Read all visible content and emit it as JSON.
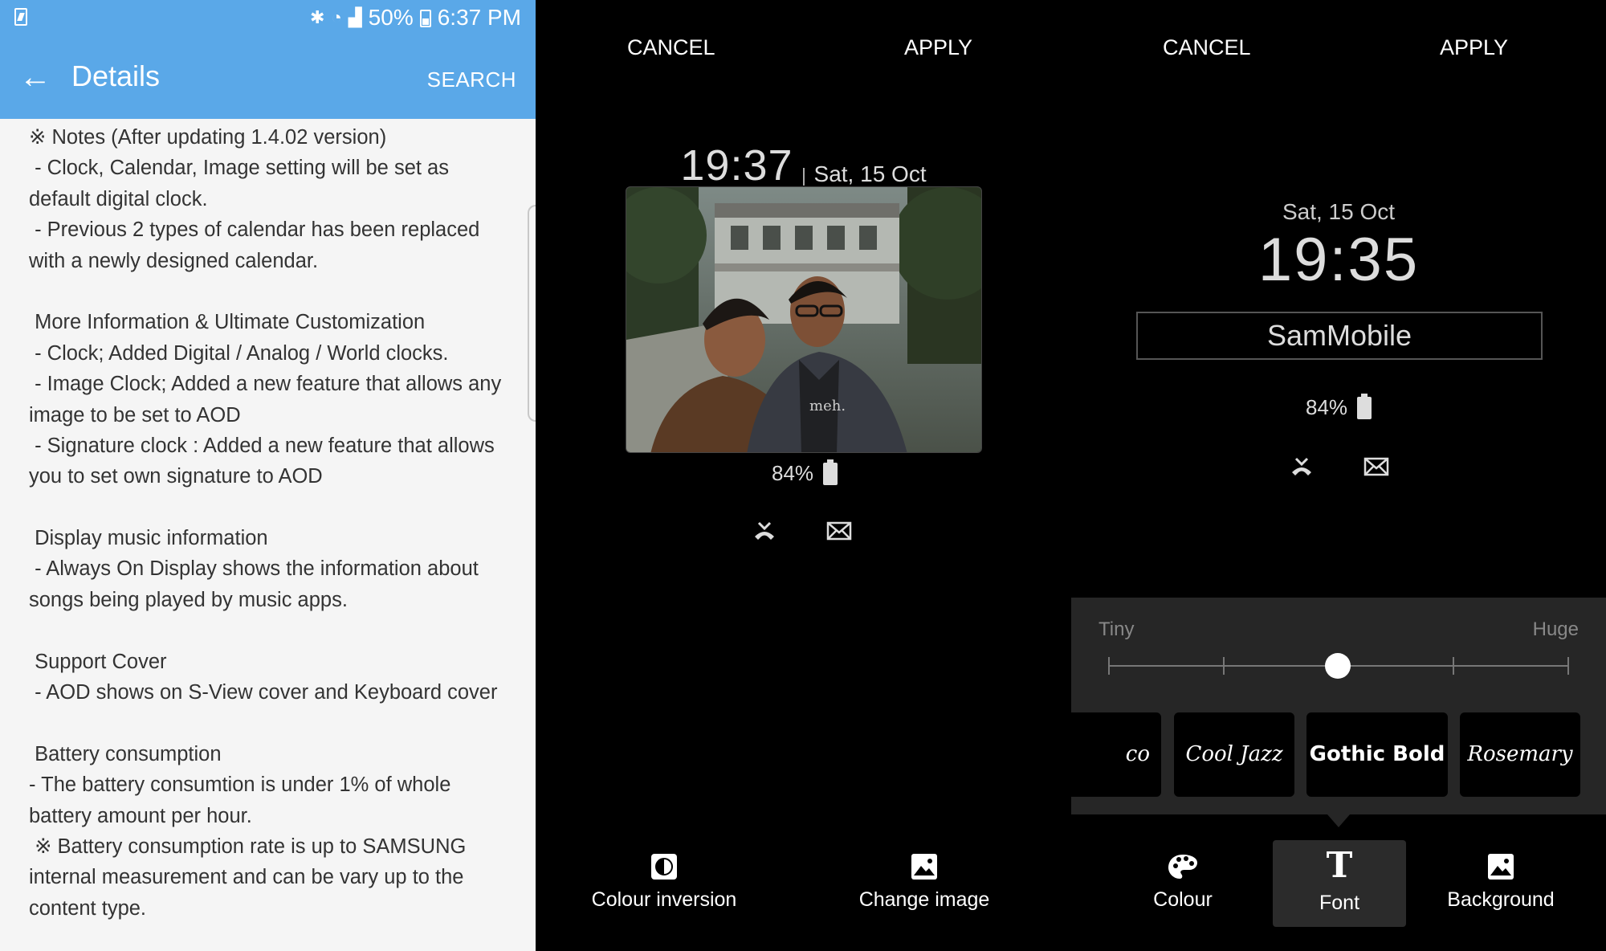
{
  "panel1": {
    "status": {
      "battery": "50%",
      "time": "6:37 PM"
    },
    "appbar": {
      "back_glyph": "←",
      "title": "Details",
      "search": "SEARCH"
    },
    "notes": [
      "※ Notes (After updating 1.4.02 version)",
      " - Clock, Calendar, Image setting will be set as",
      "default digital clock.",
      " - Previous 2 types of calendar has been replaced",
      "with a newly designed calendar.",
      "",
      " More Information & Ultimate Customization",
      " - Clock; Added Digital / Analog / World clocks.",
      " - Image Clock; Added a new feature that allows any",
      "image to be set to AOD",
      " - Signature clock : Added a new feature that allows",
      "you to set own signature to AOD",
      "",
      " Display music information",
      " - Always On Display shows the information about",
      "songs being played by music apps.",
      "",
      " Support Cover",
      " - AOD shows on S-View cover and Keyboard cover",
      "",
      " Battery consumption",
      "- The battery consumtion is under 1% of whole",
      "battery amount per hour.",
      " ※ Battery consumption rate is up to SAMSUNG",
      "internal measurement and can be vary up to the",
      "content type."
    ]
  },
  "panel2": {
    "cancel": "CANCEL",
    "apply": "APPLY",
    "time": "19:37",
    "date": "Sat, 15 Oct",
    "photo_text": "meh.",
    "battery": "84%",
    "options": [
      {
        "label": "Colour inversion",
        "icon": "colour-inversion-icon"
      },
      {
        "label": "Change image",
        "icon": "image-icon"
      }
    ]
  },
  "panel3": {
    "cancel": "CANCEL",
    "apply": "APPLY",
    "date": "Sat, 15 Oct",
    "time": "19:35",
    "signature": "SamMobile",
    "battery": "84%",
    "size": {
      "min_label": "Tiny",
      "max_label": "Huge",
      "steps": 5,
      "selected_step": 3
    },
    "fonts": [
      "co cooky",
      "Cool Jazz",
      "Gothic Bold",
      "Rosemary"
    ],
    "selected_font": "Gothic Bold",
    "tabs": [
      {
        "label": "Colour",
        "icon": "palette-icon"
      },
      {
        "label": "Font",
        "icon": "font-icon",
        "selected": true
      },
      {
        "label": "Background",
        "icon": "image-icon"
      }
    ]
  },
  "colors": {
    "accent_blue": "#5aa8e8",
    "panel_bg_dark": "#262626"
  }
}
